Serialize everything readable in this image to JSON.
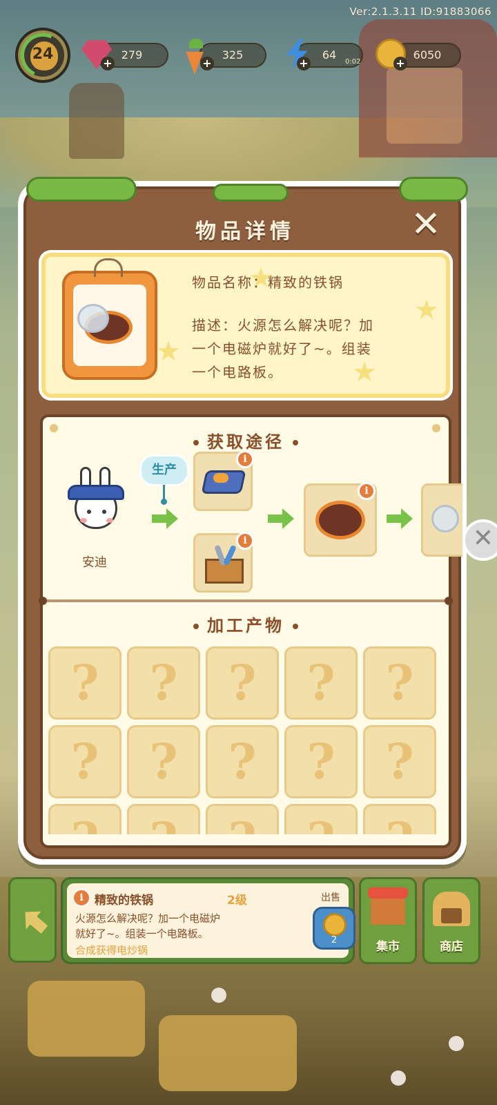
{
  "hud": {
    "version": "Ver:2.1.3.11  ID:91883066",
    "level": "24",
    "gems": "279",
    "carrots": "325",
    "energy": "64",
    "energy_timer": "0:02",
    "coins": "6050"
  },
  "dialog": {
    "title": "物品详情",
    "item_name_line": "物品名称：精致的铁锅",
    "desc_line1": "描述：火源怎么解决呢？加",
    "desc_line2": "一个电磁炉就好了~。组装",
    "desc_line3": "一个电路板。",
    "acquire_title": "获取途径",
    "produce_bubble": "生产",
    "npc_name": "安迪",
    "info_badge": "i",
    "process_title": "加工产物",
    "unknown_symbol": "?"
  },
  "bottom_bar": {
    "item_name": "精致的铁锅",
    "item_level": "2级",
    "desc_line1": "火源怎么解决呢？加一个电磁炉",
    "desc_line2": "就好了~。组装一个电路板。",
    "hint": "合成获得电炒锅",
    "sell_label": "出售",
    "sell_price": "2",
    "market_label": "集市",
    "shop_label": "商店"
  },
  "colors": {
    "panel_brown": "#8e5f3f",
    "title_text": "#fff3df",
    "body_text": "#8a4f2a",
    "card_yellow": "#fff5c8",
    "button_green": "#6f9f3e",
    "info_orange": "#e37d3b",
    "arrow_green": "#78c24a"
  },
  "icons": [
    "gem-icon",
    "carrot-icon",
    "energy-icon",
    "coin-icon",
    "close-icon",
    "info-icon",
    "arrow-right-icon",
    "question-icon",
    "back-arrow-icon",
    "market-icon",
    "shop-icon"
  ]
}
